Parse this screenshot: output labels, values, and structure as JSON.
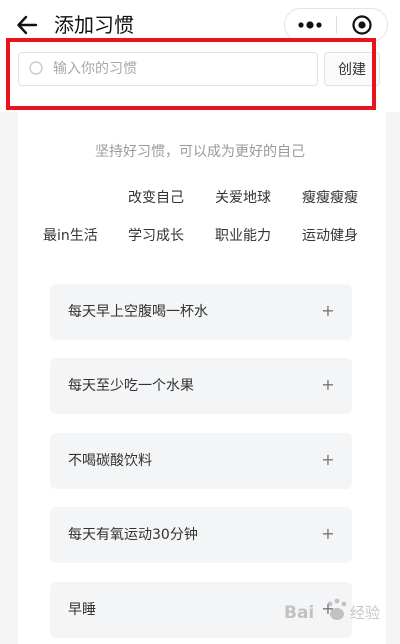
{
  "header": {
    "title": "添加习惯"
  },
  "search": {
    "placeholder": "输入你的习惯",
    "value": "",
    "create_label": "创建"
  },
  "slogan": "坚持好习惯，可以成为更好的自己",
  "categories": [
    "改变自己",
    "关爱地球",
    "瘦瘦瘦瘦",
    "最in生活",
    "学习成长",
    "职业能力",
    "运动健身"
  ],
  "habits": [
    {
      "label": "每天早上空腹喝一杯水",
      "action": "+"
    },
    {
      "label": "每天至少吃一个水果",
      "action": "+"
    },
    {
      "label": "不喝碳酸饮料",
      "action": "+"
    },
    {
      "label": "每天有氧运动30分钟",
      "action": "+"
    },
    {
      "label": "早睡",
      "action": "+"
    }
  ],
  "colors": {
    "highlight": "#e8131c",
    "habit_bg": "#f4f5f7",
    "slogan_text": "#9a9a9a"
  },
  "watermark": {
    "text": "Bai 经验"
  }
}
